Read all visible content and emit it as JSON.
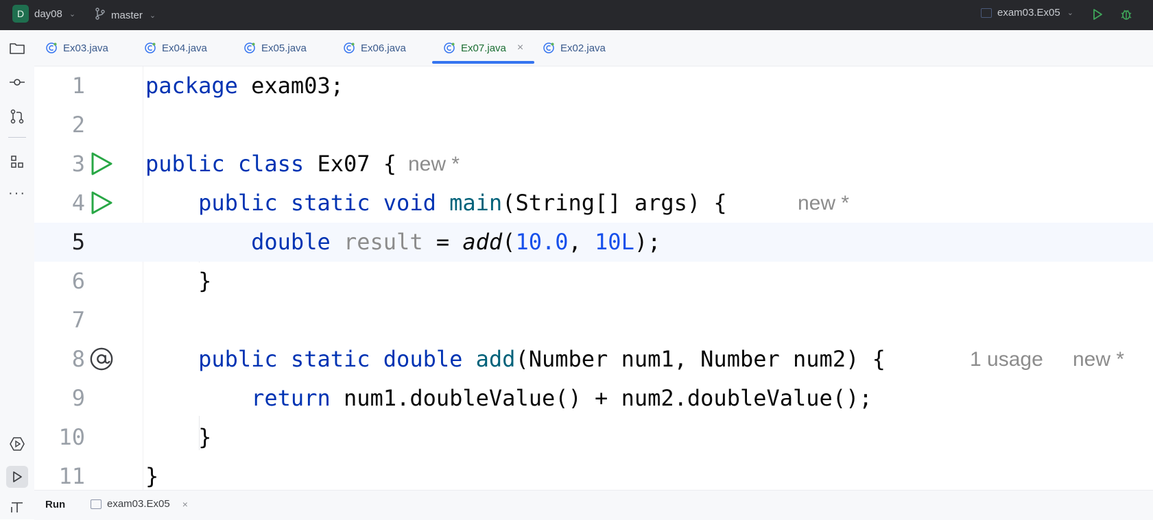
{
  "titlebar": {
    "project_badge": "D",
    "project_name": "day08",
    "branch": "master",
    "run_config": "exam03.Ex05",
    "icons": [
      "branch-icon",
      "run-icon",
      "debug-icon"
    ]
  },
  "leftstrip": {
    "icons": [
      "folder-icon",
      "commit-icon",
      "pull-requests-icon",
      "structure-icon",
      "more-icon",
      "services-icon",
      "run-tool-icon",
      "terminal-icon"
    ]
  },
  "tabs": [
    {
      "label": "Ex03.java"
    },
    {
      "label": "Ex04.java"
    },
    {
      "label": "Ex05.java"
    },
    {
      "label": "Ex06.java"
    },
    {
      "label": "Ex07.java",
      "active": true
    },
    {
      "label": "Ex02.java"
    }
  ],
  "editor": {
    "current_line": 5,
    "line_numbers": [
      "1",
      "2",
      "3",
      "4",
      "5",
      "6",
      "7",
      "8",
      "9",
      "10",
      "11"
    ],
    "hints": {
      "class_new": "new *",
      "main_new": "new *",
      "add_usage": "1 usage",
      "add_new": "new *"
    },
    "lines": {
      "l1": {
        "kw": "package",
        "rest": " exam03;"
      },
      "l3": {
        "kw1": "public",
        "kw2": "class",
        "rest": " Ex07 {"
      },
      "l4": {
        "kw1": "public",
        "kw2": "static",
        "kw3": "void",
        "fn": "main",
        "rest": "(String[] args) {"
      },
      "l5": {
        "kw": "double",
        "var": "result",
        "eq": " = ",
        "call": "add",
        "p1": "(",
        "n1": "10.0",
        "comma": ", ",
        "n2": "10L",
        "end": ");"
      },
      "l6": "}",
      "l8": {
        "kw1": "public",
        "kw2": "static",
        "kw3": "double",
        "fn": "add",
        "rest": "(Number num1, Number num2) {"
      },
      "l9": {
        "kw": "return",
        "rest": " num1.doubleValue() + num2.doubleValue();"
      },
      "l10": "}",
      "l11": "}"
    }
  },
  "bottom": {
    "run_label": "Run",
    "run_tab": "exam03.Ex05"
  },
  "colors": {
    "keyword": "#0033b3",
    "method": "#00627a",
    "number": "#1750eb",
    "active_tab_underline": "#3574f0",
    "run_gutter": "#28a745"
  }
}
